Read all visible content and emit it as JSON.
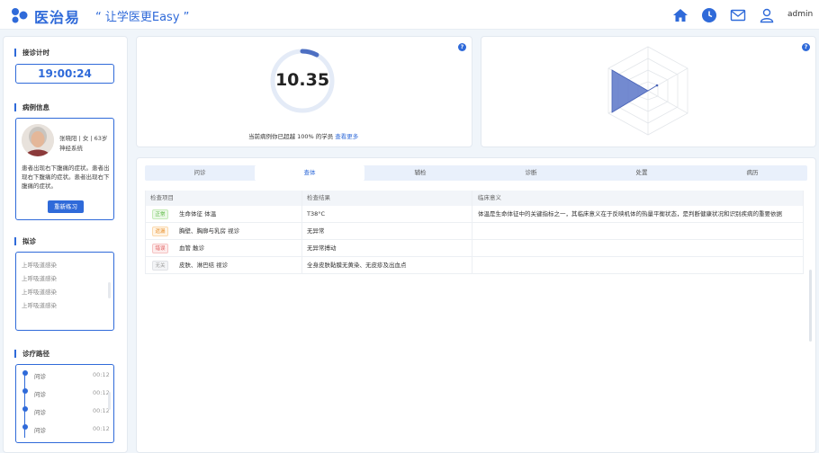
{
  "header": {
    "app_name": "医治易",
    "slogan": "“ 让学医更Easy ”",
    "user": "admin",
    "icons": [
      "home-icon",
      "clock-icon",
      "mail-icon",
      "user-icon"
    ],
    "accent": "#2f6ad9"
  },
  "sidebar": {
    "timer_title": "接诊计时",
    "timer_value": "19:00:24",
    "case_title": "病例信息",
    "patient_line1": "张晓阳 | 女 | 63岁",
    "patient_line2": "神经系统",
    "patient_desc": "患者出现右下腹痛的症状。患者出现右下腹痛的症状。患者出现右下腹痛的症状。",
    "retry_button": "重新练习",
    "diagnosis_title": "拟诊",
    "diagnosis_items": [
      "上呼吸道感染",
      "上呼吸道感染",
      "上呼吸道感染",
      "上呼吸道感染"
    ],
    "path_title": "诊疗路径",
    "path_items": [
      {
        "label": "问诊",
        "time": "00:12"
      },
      {
        "label": "问诊",
        "time": "00:12"
      },
      {
        "label": "问诊",
        "time": "00:12"
      },
      {
        "label": "问诊",
        "time": "00:12"
      }
    ]
  },
  "score": {
    "value": "10.35",
    "progress": 0.08,
    "beat_text": "当前病例你已超越 100% 的学员",
    "more_link": "查看更多"
  },
  "tabs": [
    "问诊",
    "查体",
    "辅检",
    "诊断",
    "处置",
    "病历"
  ],
  "active_tab": 1,
  "table": {
    "headers": [
      "检查项目",
      "检查结果",
      "临床意义"
    ],
    "rows": [
      {
        "tag": "正常",
        "tag_color": "green",
        "item": "生命体征 体温",
        "result": "T38°C",
        "meaning": "体温是生命体征中的关键指标之一，其临床意义在于反映机体的热量平衡状态，是判断健康状况和识别疾病的重要依据"
      },
      {
        "tag": "遗漏",
        "tag_color": "orange",
        "item": "胸壁、胸廓与乳房 视诊",
        "result": "无异常",
        "meaning": ""
      },
      {
        "tag": "错误",
        "tag_color": "red",
        "item": "血管 触诊",
        "result": "无异常搏动",
        "meaning": ""
      },
      {
        "tag": "无关",
        "tag_color": "gray",
        "item": "皮肤、淋巴结 视诊",
        "result": "全身皮肤黏膜无黄染、无皮疹及出血点",
        "meaning": ""
      }
    ]
  }
}
